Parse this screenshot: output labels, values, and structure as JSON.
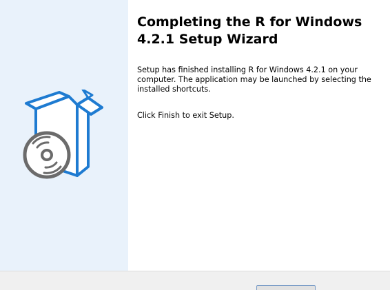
{
  "wizard": {
    "title": "Completing the R for Windows 4.2.1 Setup Wizard",
    "paragraph1": "Setup has finished installing R for Windows 4.2.1 on your computer. The application may be launched by selecting the installed shortcuts.",
    "paragraph2": "Click Finish to exit Setup."
  },
  "colors": {
    "left_panel_bg": "#e9f2fb",
    "box_outline": "#1e7bd1",
    "disc_gray": "#6b6b6b"
  },
  "icons": {
    "setup_graphic": "software-box-with-disc-icon"
  }
}
